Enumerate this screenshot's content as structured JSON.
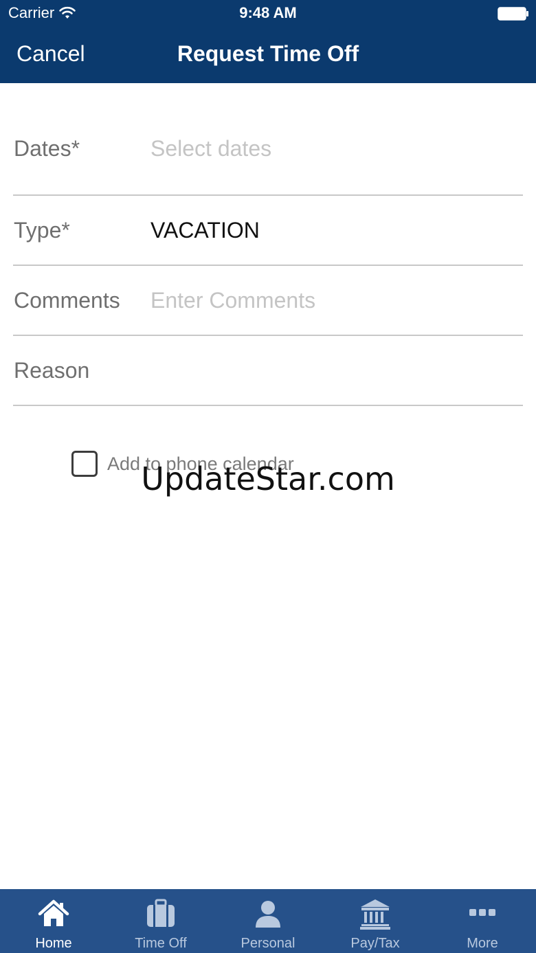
{
  "status_bar": {
    "carrier": "Carrier",
    "time": "9:48 AM"
  },
  "nav": {
    "cancel_label": "Cancel",
    "title": "Request Time Off"
  },
  "form": {
    "dates": {
      "label": "Dates*",
      "placeholder": "Select dates"
    },
    "type": {
      "label": "Type*",
      "value": "VACATION"
    },
    "comments": {
      "label": "Comments",
      "placeholder": "Enter Comments"
    },
    "reason": {
      "label": "Reason",
      "value": ""
    }
  },
  "calendar_option": {
    "label": "Add to phone calendar",
    "checked": false
  },
  "watermark": "UpdateStar.com",
  "tab_bar": {
    "tabs": [
      {
        "label": "Home",
        "icon": "home-icon",
        "active": true
      },
      {
        "label": "Time Off",
        "icon": "suitcase-icon",
        "active": false
      },
      {
        "label": "Personal",
        "icon": "person-icon",
        "active": false
      },
      {
        "label": "Pay/Tax",
        "icon": "bank-icon",
        "active": false
      },
      {
        "label": "More",
        "icon": "more-dots-icon",
        "active": false
      }
    ]
  },
  "colors": {
    "header_bg": "#0b3a6e",
    "tab_bar_bg": "#26518a",
    "tab_active": "#ffffff",
    "tab_inactive": "#b9c9df"
  }
}
